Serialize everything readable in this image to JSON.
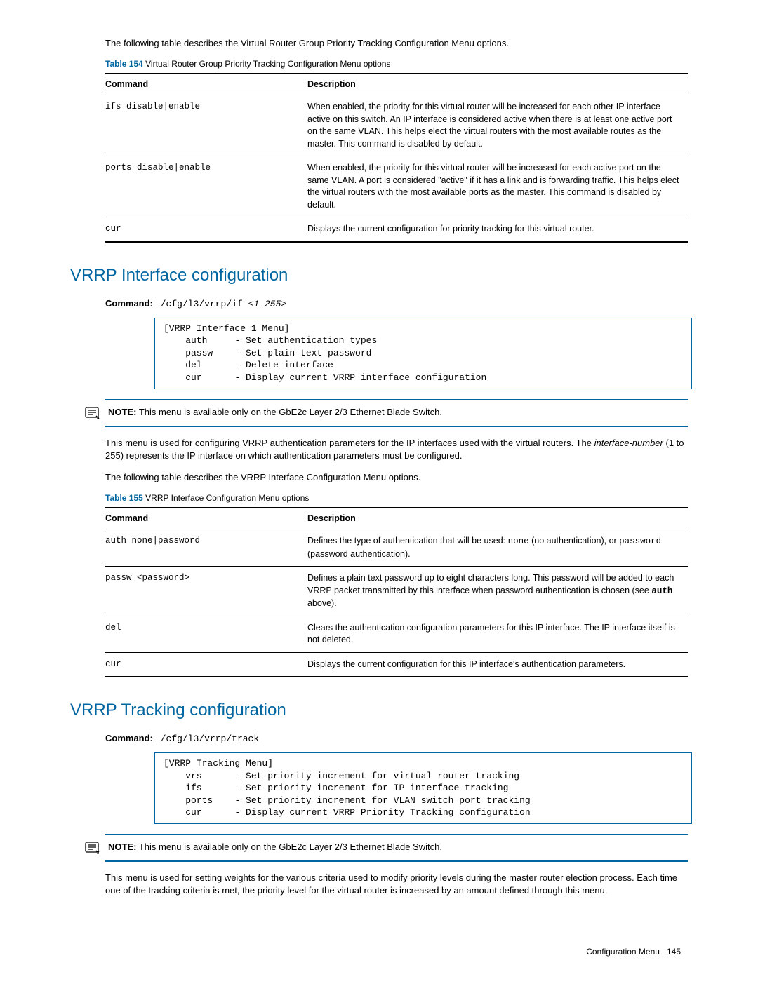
{
  "intro_154": "The following table describes the Virtual Router Group Priority Tracking Configuration Menu options.",
  "table154": {
    "label": "Table 154",
    "caption": " Virtual Router Group Priority Tracking Configuration Menu options",
    "head_cmd": "Command",
    "head_desc": "Description",
    "rows": [
      {
        "cmd": "ifs disable|enable",
        "desc": "When enabled, the priority for this virtual router will be increased for each other IP interface active on this switch. An IP interface is considered active when there is at least one active port on the same VLAN. This helps elect the virtual routers with the most available routes as the master. This command is disabled by default."
      },
      {
        "cmd": "ports disable|enable",
        "desc": "When enabled, the priority for this virtual router will be increased for each active port on the same VLAN. A port is considered \"active\" if it has a link and is forwarding traffic. This helps elect the virtual routers with the most available ports as the master. This command is disabled by default."
      },
      {
        "cmd": "cur",
        "desc": "Displays the current configuration for priority tracking for this virtual router."
      }
    ]
  },
  "section_if": {
    "heading": "VRRP Interface configuration",
    "cmd_label": "Command:",
    "cmd_value": "/cfg/l3/vrrp/if ",
    "cmd_arg": "<1-255>",
    "menu": "[VRRP Interface 1 Menu]\n    auth     - Set authentication types\n    passw    - Set plain-text password\n    del      - Delete interface\n    cur      - Display current VRRP interface configuration",
    "note_label": "NOTE:",
    "note_text": "  This menu is available only on the GbE2c Layer 2/3 Ethernet Blade Switch.",
    "para1a": "This menu is used for configuring VRRP authentication parameters for the IP interfaces used with the virtual routers. The ",
    "para1_ital": "interface-number",
    "para1b": " (1 to 255) represents the IP interface on which authentication parameters must be configured.",
    "intro_155": "The following table describes the VRRP Interface Configuration Menu options."
  },
  "table155": {
    "label": "Table 155",
    "caption": " VRRP Interface Configuration Menu options",
    "head_cmd": "Command",
    "head_desc": "Description",
    "rows": [
      {
        "cmd": "auth none|password",
        "desc_a": "Defines the type of authentication that will be used: ",
        "m1": "none",
        "desc_b": " (no authentication), or ",
        "m2": "password",
        "desc_c": " (password authentication)."
      },
      {
        "cmd": "passw <password>",
        "desc_a": "Defines a plain text password up to eight characters long. This password will be added to each VRRP packet transmitted by this interface when password authentication is chosen (see ",
        "m1": "auth",
        "desc_b": " above)."
      },
      {
        "cmd": "del",
        "desc": "Clears the authentication configuration parameters for this IP interface. The IP interface itself is not deleted."
      },
      {
        "cmd": "cur",
        "desc": "Displays the current configuration for this IP interface's authentication parameters."
      }
    ]
  },
  "section_track": {
    "heading": "VRRP Tracking configuration",
    "cmd_label": "Command:",
    "cmd_value": "/cfg/l3/vrrp/track",
    "menu": "[VRRP Tracking Menu]\n    vrs      - Set priority increment for virtual router tracking\n    ifs      - Set priority increment for IP interface tracking\n    ports    - Set priority increment for VLAN switch port tracking\n    cur      - Display current VRRP Priority Tracking configuration",
    "note_label": "NOTE:",
    "note_text": "  This menu is available only on the GbE2c Layer 2/3 Ethernet Blade Switch.",
    "para": "This menu is used for setting weights for the various criteria used to modify priority levels during the master router election process. Each time one of the tracking criteria is met, the priority level for the virtual router is increased by an amount defined through this menu."
  },
  "footer": {
    "section": "Configuration Menu",
    "page": "145"
  }
}
